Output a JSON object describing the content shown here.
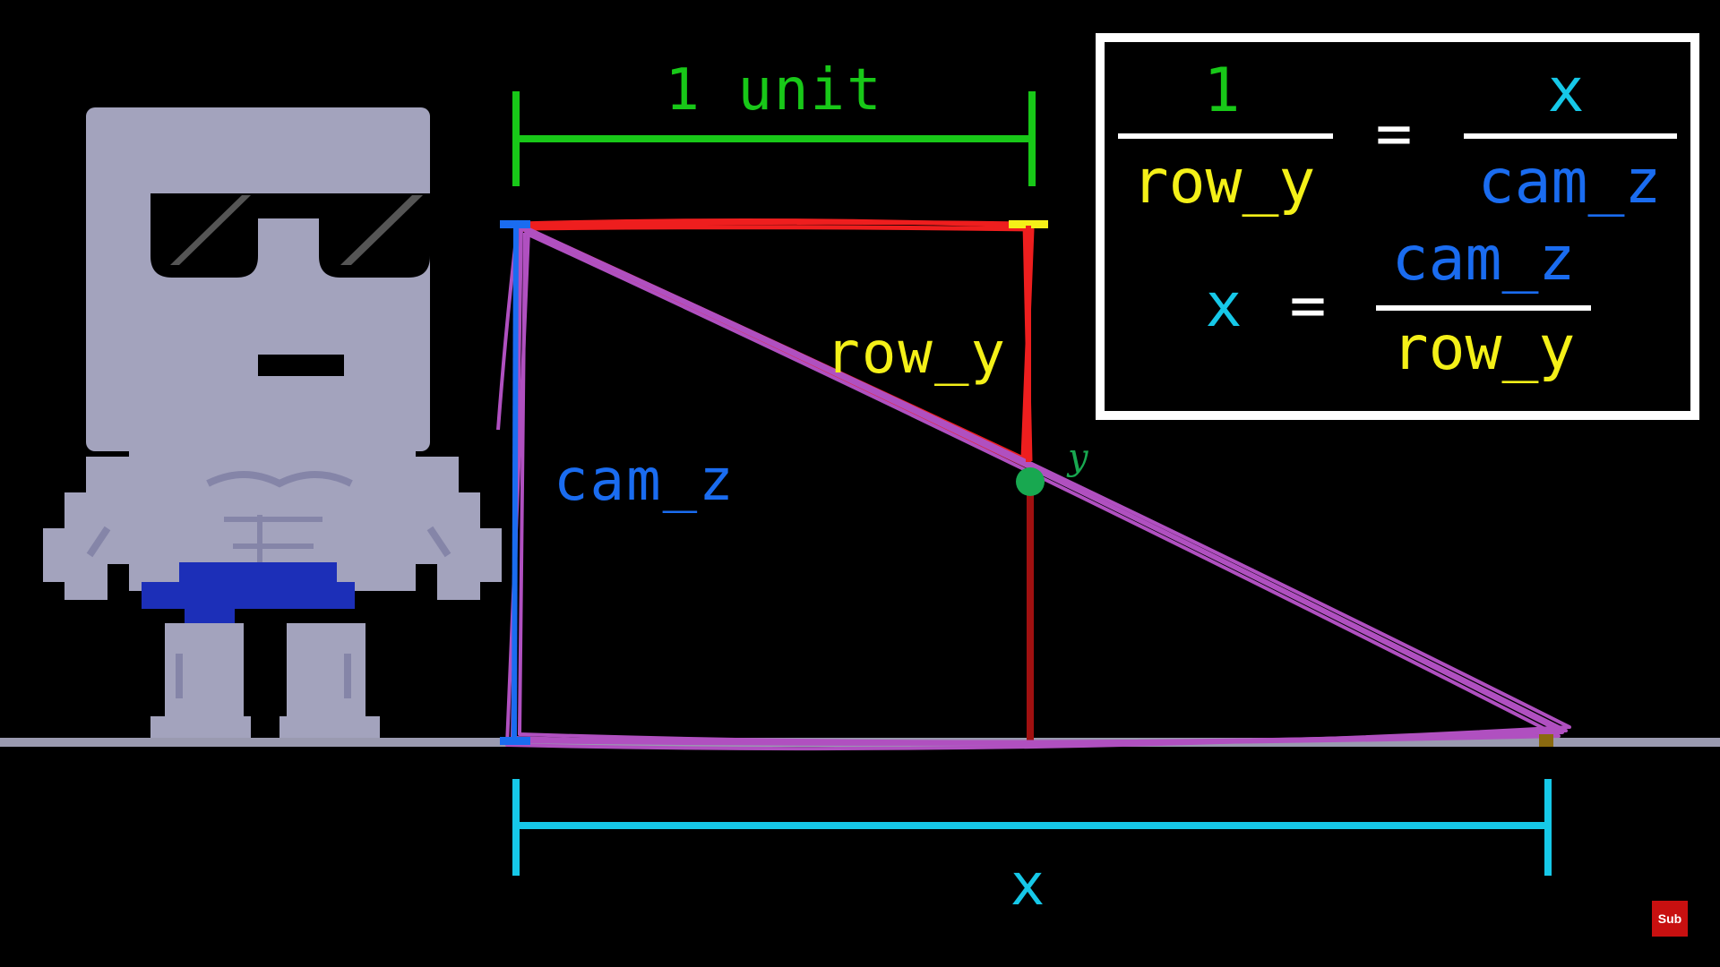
{
  "colors": {
    "background": "#000000",
    "ground": "#9a9ab0",
    "green": "#18c818",
    "cyan": "#16c8e8",
    "blue": "#1a6cf0",
    "yellow": "#f4f018",
    "red": "#ee1e1e",
    "dark_red": "#a01010",
    "purple": "#b050c0",
    "box_border": "#ffffff",
    "character_body": "#a3a3bd",
    "character_shade": "#8585a8",
    "shorts": "#1c2fb8",
    "glasses": "#000000"
  },
  "diagram": {
    "unit_label": "1 unit",
    "row_y_label": "row_y",
    "cam_z_label": "cam_z",
    "x_label": "x",
    "point_label": "y"
  },
  "formula": {
    "line1": {
      "left_num": "1",
      "left_den": "row_y",
      "equals": "=",
      "right_num": "x",
      "right_den": "cam_z"
    },
    "line2": {
      "left": "x",
      "equals": "=",
      "right_num": "cam_z",
      "right_den": "row_y"
    }
  },
  "subscribe": {
    "label": "Sub"
  }
}
